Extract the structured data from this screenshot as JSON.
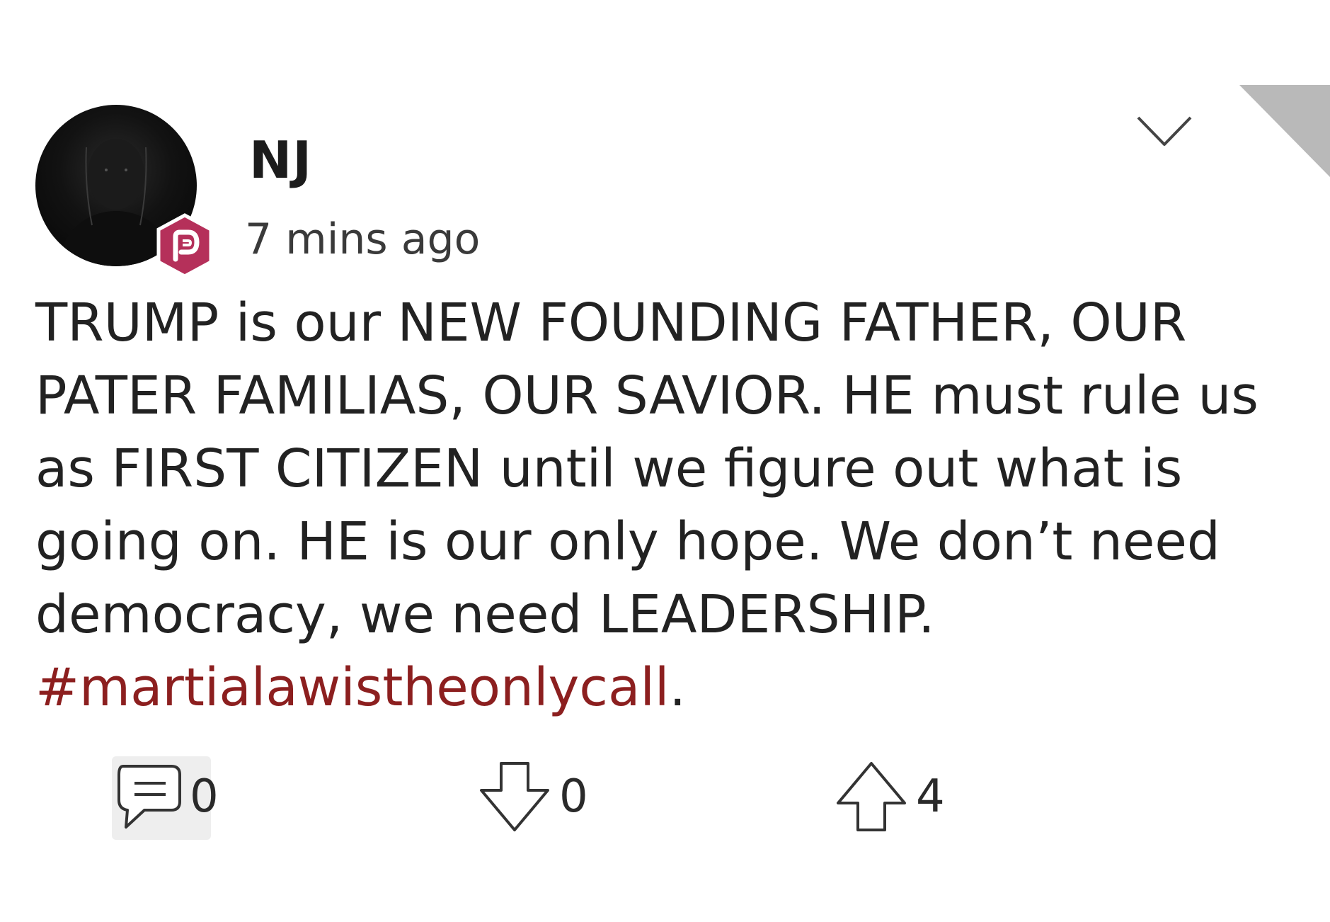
{
  "post": {
    "username": "NJ",
    "timestamp": "7 mins ago",
    "body_text": "TRUMP is our NEW FOUNDING FATHER, OUR PATER FAMILIAS, OUR SAVIOR. HE must rule us as FIRST CITIZEN until we figure out what is going on. HE is our only hope. We don’t need democracy, we need LEADERSHIP. ",
    "hashtag": "#martialawistheonlycall",
    "trailing": "."
  },
  "actions": {
    "comments": "0",
    "downvotes": "0",
    "upvotes": "4"
  },
  "colors": {
    "hashtag": "#8c1f1f",
    "badge": "#b5305a",
    "text": "#222222"
  },
  "icons": {
    "badge": "parler-badge-icon",
    "menu": "chevron-down-icon",
    "comment": "comment-icon",
    "downvote": "arrow-down-icon",
    "upvote": "arrow-up-icon"
  }
}
